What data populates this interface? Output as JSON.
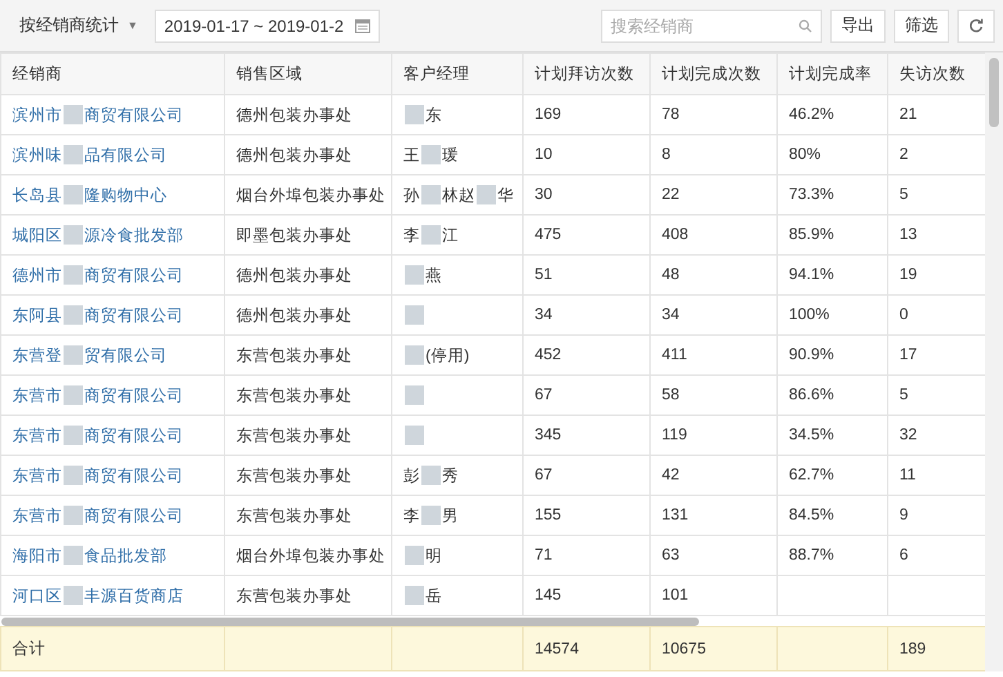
{
  "toolbar": {
    "group_by": {
      "label": "按经销商统计",
      "caret": "▼"
    },
    "date_range": {
      "value": "2019-01-17 ~ 2019-01-2"
    },
    "search": {
      "placeholder": "搜索经销商"
    },
    "buttons": [
      {
        "kind": "text",
        "label": "导出"
      },
      {
        "kind": "text",
        "label": "筛选"
      },
      {
        "kind": "refresh"
      }
    ]
  },
  "table": {
    "columns": [
      "经销商",
      "销售区域",
      "客户经理",
      "计划拜访次数",
      "计划完成次数",
      "计划完成率",
      "失访次数"
    ],
    "rows": [
      {
        "dealer": [
          {
            "text": "滨州市"
          },
          {
            "kind": "blur"
          },
          {
            "text": "商贸有限公司"
          }
        ],
        "region": "德州包装办事处",
        "manager": [
          {
            "kind": "blur"
          },
          {
            "text": "东"
          }
        ],
        "planned": "169",
        "completed": "78",
        "rate": "46.2%",
        "missed": "21"
      },
      {
        "dealer": [
          {
            "text": "滨州味"
          },
          {
            "kind": "blur"
          },
          {
            "text": "品有限公司"
          }
        ],
        "region": "德州包装办事处",
        "manager": [
          {
            "text": "王"
          },
          {
            "kind": "blur"
          },
          {
            "text": "瑗"
          }
        ],
        "planned": "10",
        "completed": "8",
        "rate": "80%",
        "missed": "2"
      },
      {
        "dealer": [
          {
            "text": "长岛县"
          },
          {
            "kind": "blur"
          },
          {
            "text": "隆购物中心"
          }
        ],
        "region": "烟台外埠包装办事处",
        "manager": [
          {
            "text": "孙"
          },
          {
            "kind": "blur"
          },
          {
            "text": "林赵"
          },
          {
            "kind": "blur"
          },
          {
            "text": "华"
          }
        ],
        "planned": "30",
        "completed": "22",
        "rate": "73.3%",
        "missed": "5"
      },
      {
        "dealer": [
          {
            "text": "城阳区"
          },
          {
            "kind": "blur"
          },
          {
            "text": "源冷食批发部"
          }
        ],
        "region": "即墨包装办事处",
        "manager": [
          {
            "text": "李"
          },
          {
            "kind": "blur"
          },
          {
            "text": "江"
          }
        ],
        "planned": "475",
        "completed": "408",
        "rate": "85.9%",
        "missed": "13"
      },
      {
        "dealer": [
          {
            "text": "德州市"
          },
          {
            "kind": "blur"
          },
          {
            "text": "商贸有限公司"
          }
        ],
        "region": "德州包装办事处",
        "manager": [
          {
            "kind": "blur"
          },
          {
            "text": "燕"
          }
        ],
        "planned": "51",
        "completed": "48",
        "rate": "94.1%",
        "missed": "19"
      },
      {
        "dealer": [
          {
            "text": "东阿县"
          },
          {
            "kind": "blur"
          },
          {
            "text": "商贸有限公司"
          }
        ],
        "region": "德州包装办事处",
        "manager": [
          {
            "kind": "blur"
          }
        ],
        "planned": "34",
        "completed": "34",
        "rate": "100%",
        "missed": "0"
      },
      {
        "dealer": [
          {
            "text": "东营登"
          },
          {
            "kind": "blur"
          },
          {
            "text": "贸有限公司"
          }
        ],
        "region": "东营包装办事处",
        "manager": [
          {
            "kind": "blur"
          },
          {
            "text": "(停用)"
          }
        ],
        "planned": "452",
        "completed": "411",
        "rate": "90.9%",
        "missed": "17"
      },
      {
        "dealer": [
          {
            "text": "东营市"
          },
          {
            "kind": "blur"
          },
          {
            "text": "商贸有限公司"
          }
        ],
        "region": "东营包装办事处",
        "manager": [
          {
            "kind": "blur"
          }
        ],
        "planned": "67",
        "completed": "58",
        "rate": "86.6%",
        "missed": "5"
      },
      {
        "dealer": [
          {
            "text": "东营市"
          },
          {
            "kind": "blur"
          },
          {
            "text": "商贸有限公司"
          }
        ],
        "region": "东营包装办事处",
        "manager": [
          {
            "kind": "blur"
          }
        ],
        "planned": "345",
        "completed": "119",
        "rate": "34.5%",
        "missed": "32"
      },
      {
        "dealer": [
          {
            "text": "东营市"
          },
          {
            "kind": "blur"
          },
          {
            "text": "商贸有限公司"
          }
        ],
        "region": "东营包装办事处",
        "manager": [
          {
            "text": "彭"
          },
          {
            "kind": "blur"
          },
          {
            "text": "秀"
          }
        ],
        "planned": "67",
        "completed": "42",
        "rate": "62.7%",
        "missed": "11"
      },
      {
        "dealer": [
          {
            "text": "东营市"
          },
          {
            "kind": "blur"
          },
          {
            "text": "商贸有限公司"
          }
        ],
        "region": "东营包装办事处",
        "manager": [
          {
            "text": "李"
          },
          {
            "kind": "blur"
          },
          {
            "text": "男"
          }
        ],
        "planned": "155",
        "completed": "131",
        "rate": "84.5%",
        "missed": "9"
      },
      {
        "dealer": [
          {
            "text": "海阳市"
          },
          {
            "kind": "blur"
          },
          {
            "text": "食品批发部"
          }
        ],
        "region": "烟台外埠包装办事处",
        "manager": [
          {
            "kind": "blur"
          },
          {
            "text": "明"
          }
        ],
        "planned": "71",
        "completed": "63",
        "rate": "88.7%",
        "missed": "6"
      },
      {
        "dealer": [
          {
            "text": "河口区"
          },
          {
            "kind": "blur"
          },
          {
            "text": "丰源百货商店"
          }
        ],
        "region": "东营包装办事处",
        "manager": [
          {
            "kind": "blur"
          },
          {
            "text": "岳"
          }
        ],
        "planned": "145",
        "completed": "101"
      }
    ],
    "total": {
      "label": "合计",
      "planned": "14574",
      "completed": "10675",
      "missed": "189"
    }
  }
}
